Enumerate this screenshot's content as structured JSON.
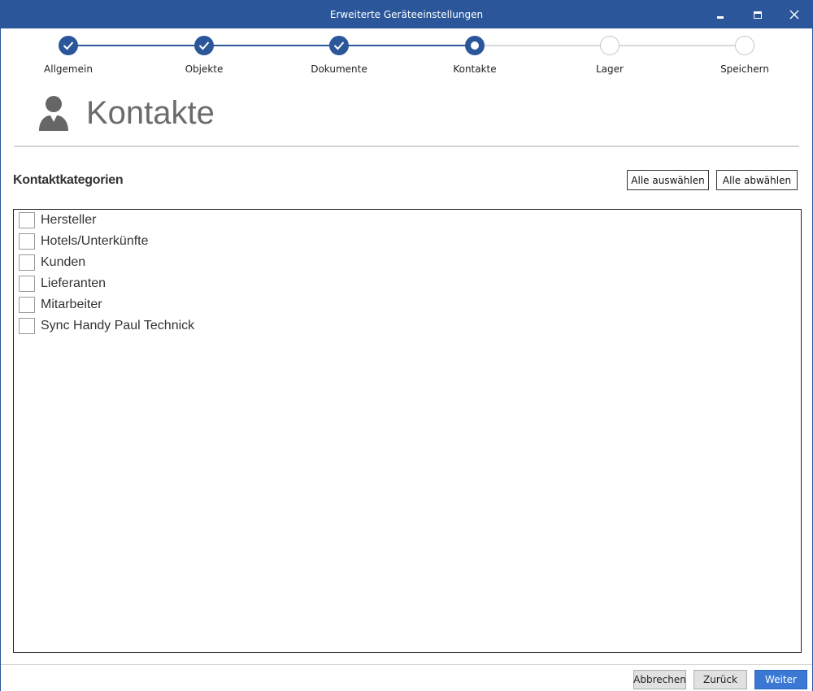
{
  "window": {
    "title": "Erweiterte Geräteeinstellungen"
  },
  "stepper": {
    "steps": [
      {
        "label": "Allgemein",
        "state": "done"
      },
      {
        "label": "Objekte",
        "state": "done"
      },
      {
        "label": "Dokumente",
        "state": "done"
      },
      {
        "label": "Kontakte",
        "state": "current"
      },
      {
        "label": "Lager",
        "state": "todo"
      },
      {
        "label": "Speichern",
        "state": "todo"
      }
    ]
  },
  "page": {
    "title": "Kontakte",
    "icon": "person-icon"
  },
  "categories": {
    "label": "Kontaktkategorien",
    "select_all_label": "Alle auswählen",
    "deselect_all_label": "Alle abwählen",
    "items": [
      {
        "label": "Hersteller",
        "checked": false
      },
      {
        "label": "Hotels/Unterkünfte",
        "checked": false
      },
      {
        "label": "Kunden",
        "checked": false
      },
      {
        "label": "Lieferanten",
        "checked": false
      },
      {
        "label": "Mitarbeiter",
        "checked": false
      },
      {
        "label": "Sync Handy Paul Technick",
        "checked": false
      }
    ]
  },
  "footer": {
    "cancel_label": "Abbrechen",
    "back_label": "Zurück",
    "next_label": "Weiter"
  },
  "colors": {
    "accent": "#2b579a",
    "primary_button": "#3a78d4",
    "step_todo": "#d8d8d8"
  }
}
